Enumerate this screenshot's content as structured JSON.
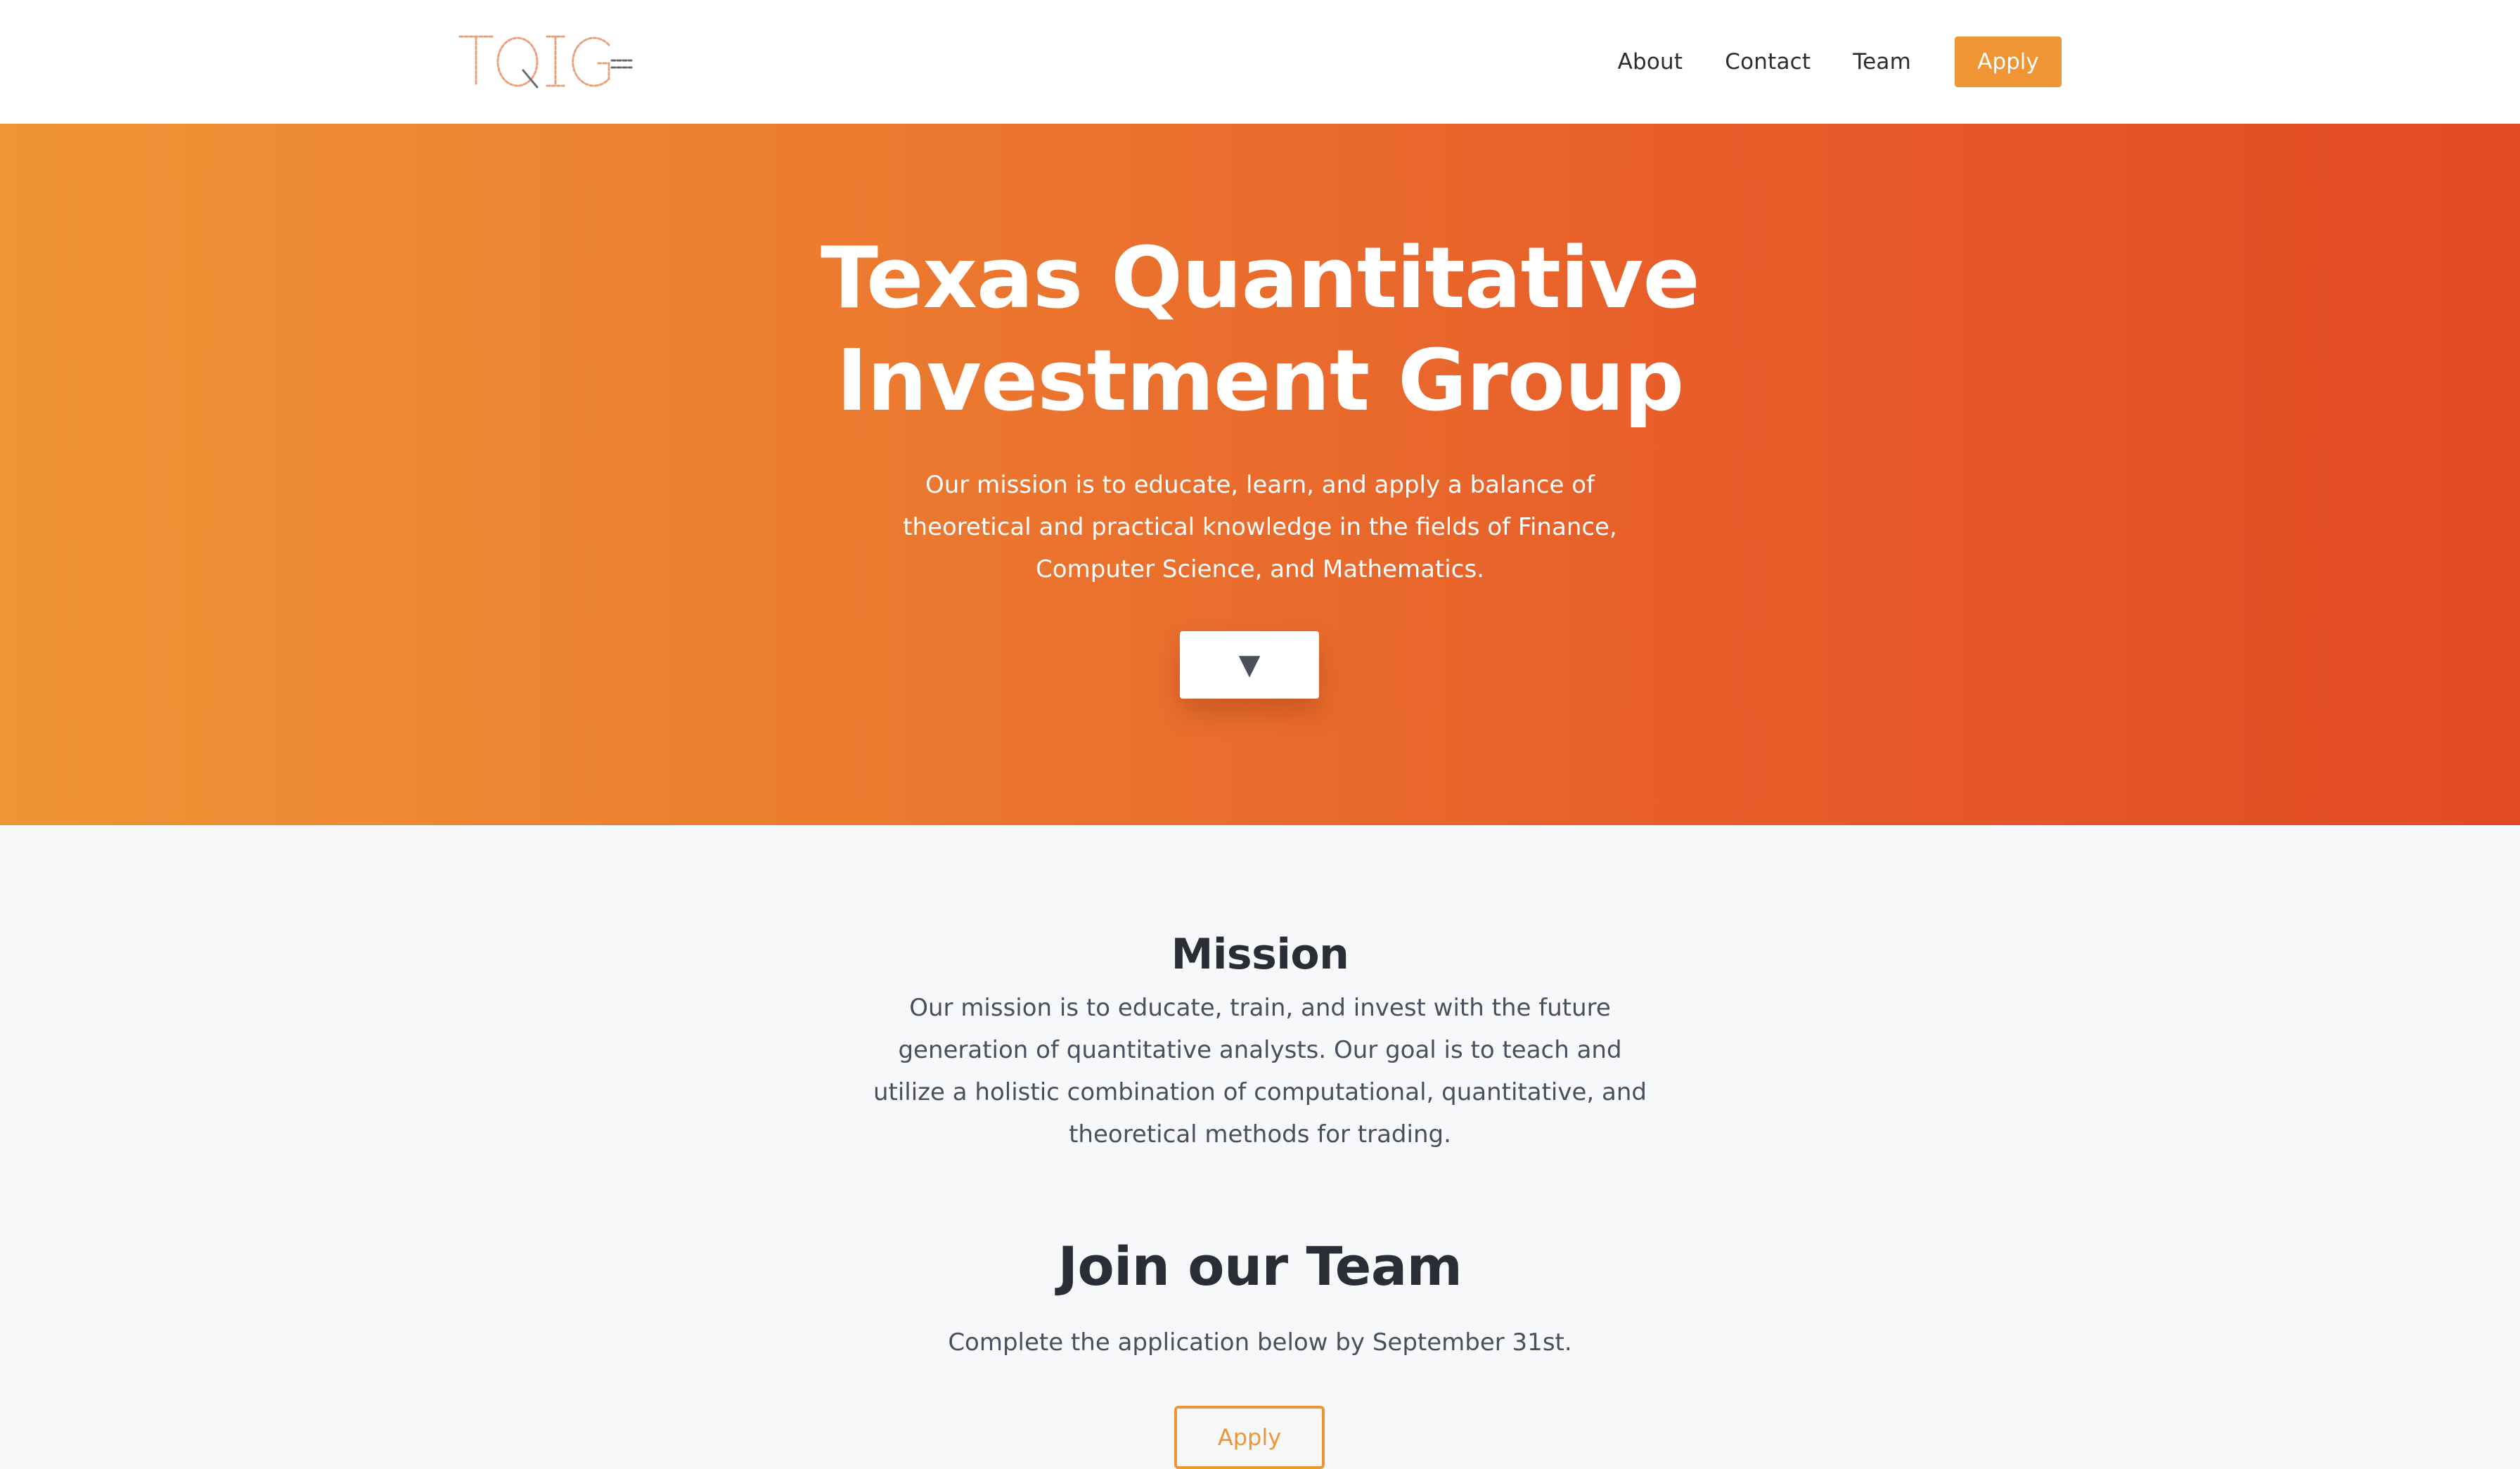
{
  "nav": {
    "logo_text": "TQIG",
    "links": [
      {
        "label": "About"
      },
      {
        "label": "Contact"
      },
      {
        "label": "Team"
      }
    ],
    "apply_label": "Apply"
  },
  "hero": {
    "title_line1": "Texas Quantitative",
    "title_line2": "Investment Group",
    "description": "Our mission is to educate, learn, and apply a balance of theoretical and practical knowledge in the fields of Finance, Computer Science, and Mathematics.",
    "down_arrow": "▼"
  },
  "mission": {
    "title": "Mission",
    "text": "Our mission is to educate, train, and invest with the future generation of quantitative analysts. Our goal is to teach and utilize a holistic combination of computational, quantitative, and theoretical methods for trading."
  },
  "join": {
    "title": "Join our Team",
    "text": "Complete the application below by September 31st.",
    "apply_label": "Apply"
  },
  "colors": {
    "accent": "#ef9533",
    "hero_gradient_start": "#ef9536",
    "hero_gradient_end": "#e24a25",
    "text_dark": "#2a2d36",
    "text_body": "#4b4f5c",
    "page_bg": "#f7f8fa"
  }
}
